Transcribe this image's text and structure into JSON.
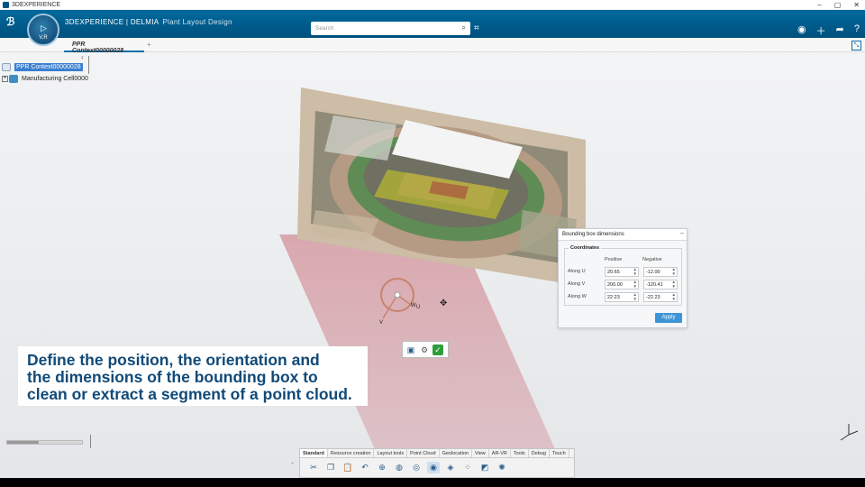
{
  "window": {
    "title": "3DEXPERIENCE",
    "controls": [
      "–",
      "▢",
      "✕"
    ]
  },
  "appbar": {
    "brand_bold": "3DEXPERIENCE | DELMIA",
    "app_name": "Plant Layout Design",
    "compass_label": "V,R",
    "search_placeholder": "Search"
  },
  "tabs": [
    {
      "label": "PPR Context00000028"
    }
  ],
  "tree": {
    "root": "PPR Context00000028",
    "child": "Manufacturing Cell0000"
  },
  "manipulator": {
    "labels": [
      "W",
      "U",
      "V"
    ]
  },
  "panel": {
    "title": "Bounding box dimensions",
    "group": "Coordinates",
    "col_positive": "Positive",
    "col_negative": "Negative",
    "rows": [
      {
        "label": "Along U",
        "positive": "20.65",
        "negative": "-12.00"
      },
      {
        "label": "Along V",
        "positive": "200.00",
        "negative": "-120.41"
      },
      {
        "label": "Along W",
        "positive": "22.23",
        "negative": "-22.23"
      }
    ],
    "apply": "Apply"
  },
  "caption": {
    "line1": "Define the position, the orientation and",
    "line2": "the dimensions of the bounding box to",
    "line3": "clean or extract a segment of a point cloud."
  },
  "actionbar": {
    "tabs": [
      "Standard",
      "Resource creation",
      "Layout tools",
      "Point Cloud",
      "Geolocation",
      "View",
      "AR-VR",
      "Tools",
      "Debug",
      "Touch"
    ],
    "active_tab": "Point Cloud"
  },
  "colors": {
    "brand": "#005386",
    "caption_text": "#114a78",
    "apply": "#3d95d6",
    "selection": "#3b7fd0"
  }
}
